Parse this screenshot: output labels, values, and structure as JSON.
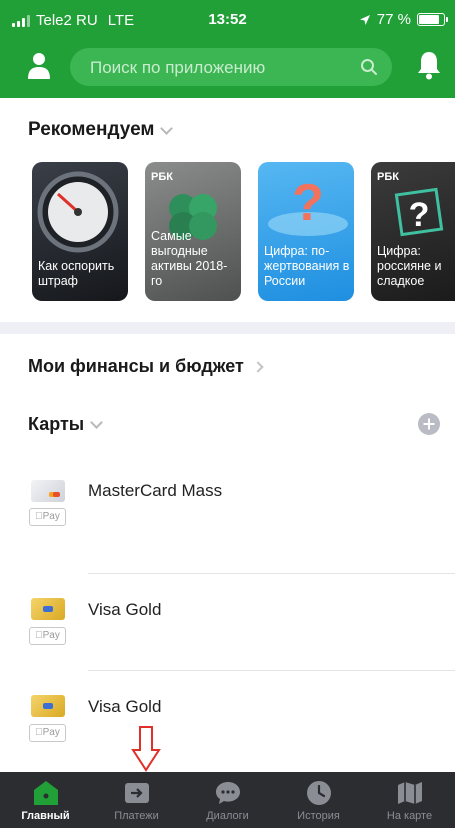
{
  "status_bar": {
    "carrier": "Tele2 RU",
    "network": "LTE",
    "time": "13:52",
    "battery": "77 %"
  },
  "header": {
    "search_placeholder": "Поиск по приложению"
  },
  "recommend": {
    "title": "Рекомендуем",
    "stories": [
      {
        "text": "Как оспорить штраф",
        "brand": ""
      },
      {
        "text": "Самые выгодные активы 2018-го",
        "brand": "РБК"
      },
      {
        "text": "Цифра: по-жертвования в России",
        "brand": ""
      },
      {
        "text": "Цифра: россияне и сладкое",
        "brand": "РБК"
      }
    ]
  },
  "finance": {
    "title": "Мои финансы и бюджет"
  },
  "cards": {
    "title": "Карты",
    "items": [
      {
        "name": "MasterCard Mass",
        "pay_label": "Pay"
      },
      {
        "name": "Visa Gold",
        "pay_label": "Pay"
      },
      {
        "name": "Visa Gold",
        "pay_label": "Pay"
      }
    ]
  },
  "tabbar": {
    "tabs": [
      {
        "label": "Главный",
        "icon": "home-icon",
        "active": true
      },
      {
        "label": "Платежи",
        "icon": "payments-icon",
        "active": false
      },
      {
        "label": "Диалоги",
        "icon": "chat-icon",
        "active": false
      },
      {
        "label": "История",
        "icon": "clock-icon",
        "active": false
      },
      {
        "label": "На карте",
        "icon": "map-icon",
        "active": false
      }
    ]
  },
  "colors": {
    "brand_green": "#21a038",
    "tabbar_bg": "#2b2d31",
    "annotation_red": "#e0302a"
  }
}
